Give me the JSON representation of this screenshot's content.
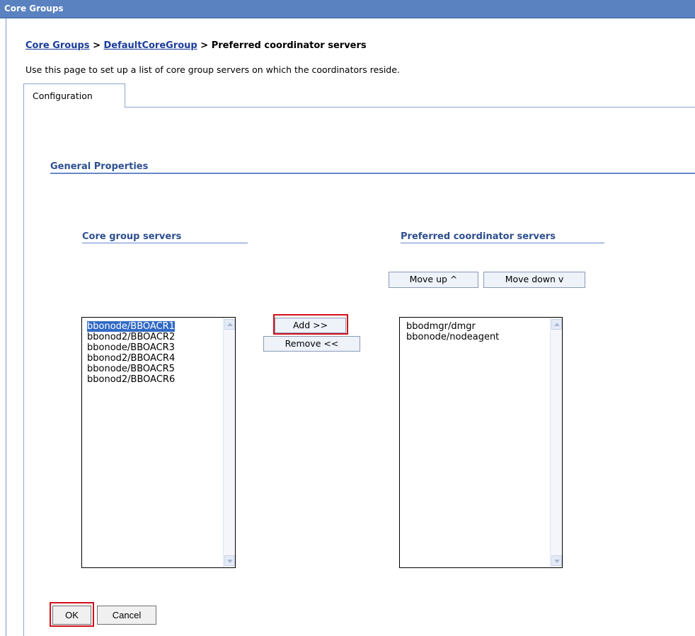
{
  "window": {
    "title": "Core Groups"
  },
  "breadcrumb": {
    "link1": "Core Groups",
    "sep1": " > ",
    "link2": "DefaultCoreGroup",
    "sep2": " > ",
    "current": "Preferred coordinator servers"
  },
  "description": "Use this page to set up a list of core group servers on which the coordinators reside.",
  "tabs": [
    {
      "label": "Configuration"
    }
  ],
  "section": {
    "title": "General Properties"
  },
  "core_group_servers": {
    "header": "Core group servers",
    "items": [
      "bbonode/BBOACR1",
      "bbonod2/BBOACR2",
      "bbonode/BBOACR3",
      "bbonod2/BBOACR4",
      "bbonode/BBOACR5",
      "bbonod2/BBOACR6"
    ],
    "selected": "bbonode/BBOACR1"
  },
  "preferred_servers": {
    "header": "Preferred coordinator servers",
    "items": [
      "bbodmgr/dmgr",
      "bbonode/nodeagent"
    ]
  },
  "buttons": {
    "move_up": "Move up ^",
    "move_down": "Move down v",
    "add": "Add >>",
    "remove": "Remove <<",
    "ok": "OK",
    "cancel": "Cancel"
  },
  "colors": {
    "titlebar": "#5a82c1",
    "link": "#1a3c99",
    "section_header": "#2e4f8f",
    "highlight_box": "#d0101a",
    "selection": "#316ac5"
  }
}
